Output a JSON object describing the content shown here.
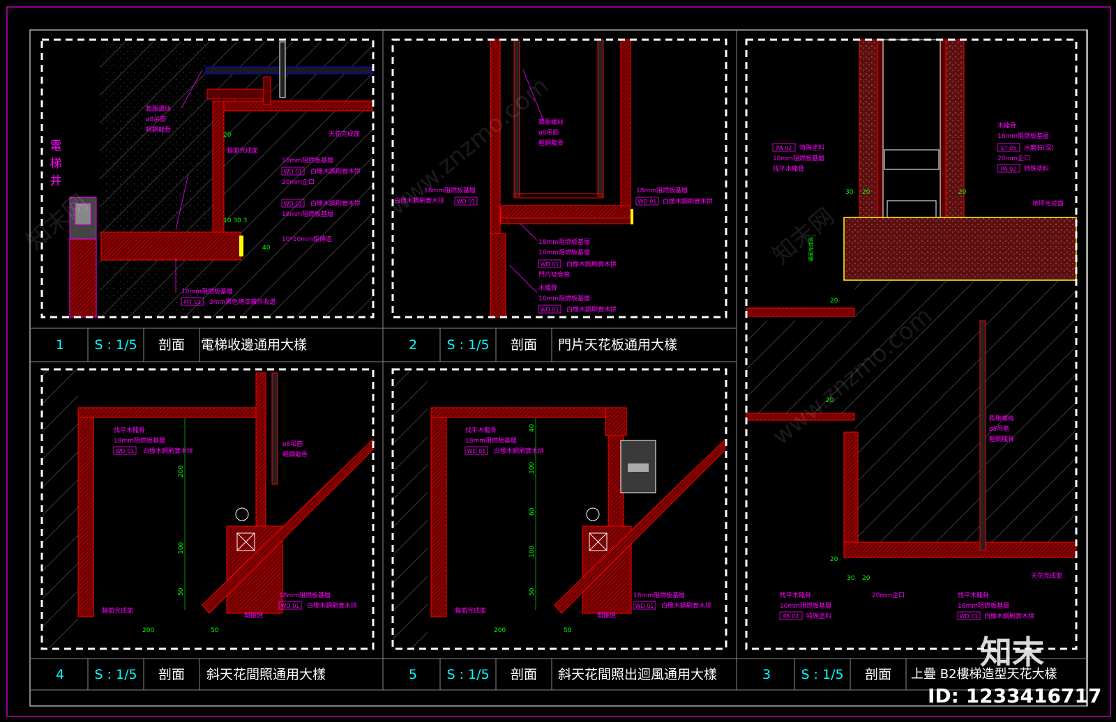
{
  "colors": {
    "frame": "#c000c0",
    "dash": "#ffffff",
    "leader": "#ff00ff",
    "wall": "#ff0000",
    "dim": "#00ff00",
    "accent": "#00ffff",
    "dark_red": "#5a0000"
  },
  "panels": [
    {
      "number": "1",
      "scale": "S : 1/5",
      "type": "剖面",
      "title": "電梯收邊通用大樣",
      "side_label": [
        "電",
        "梯",
        "井"
      ],
      "notes": [
        "膨脹螺絲",
        "ø8吊筋",
        "輕鋼龍骨",
        "天花完成面",
        "牆面完成面",
        "18mm阻燃板基層",
        "20mm企口",
        "18mm阻燃板基層",
        "10*10mm鋁條造",
        "10mm阻燃板基層",
        "3mm黑色烤漆鐵件收邊"
      ],
      "codes": [
        "WD 01",
        "WD 01",
        "MT 01"
      ],
      "code_texts": [
        "白橡木鋼刷實木拼",
        "白橡木鋼刷實木拼"
      ],
      "dims": [
        "20",
        "10 30 3",
        "40"
      ]
    },
    {
      "number": "2",
      "scale": "S : 1/5",
      "type": "剖面",
      "title": "門片天花板通用大樣",
      "notes": [
        "膨脹螺絲",
        "ø8吊筋",
        "輕鋼龍骨",
        "18mm阻燃板基層",
        "白橡木鋼刷實木拼",
        "18mm阻燃板基層",
        "18mm阻燃板基層",
        "10mm阻燃板基層",
        "白橡木鋼刷實木拼",
        "門片吸音棉",
        "木龍骨",
        "10mm阻燃板基層",
        "白橡木鋼刷實木拼"
      ],
      "codes": [
        "WD 01",
        "WD 01",
        "WD 01",
        "WD 01"
      ]
    },
    {
      "number": "3",
      "scale": "S : 1/5",
      "type": "剖面",
      "title": "上疊 B2樓梯造型天花大樣",
      "notes_top": [
        "木龍骨",
        "18mm阻燃板基層",
        "水磨石(深)",
        "20mm企口",
        "特殊塗料",
        "特殊塗料",
        "10mm阻燃板基層",
        "找平木龍骨",
        "地坪完成面"
      ],
      "codes_top": [
        "PA 02",
        "ST 05",
        "PA 02"
      ],
      "notes_bottom": [
        "膨脹螺絲",
        "ø8吊筋",
        "輕鋼龍骨",
        "天花完成面",
        "找平木龍骨",
        "10mm阻燃板基層",
        "特殊塗料",
        "20mm企口",
        "找平木龍骨",
        "18mm阻燃板基層",
        "白橡木鋼刷實木拼"
      ],
      "codes_bottom": [
        "PA 02",
        "WD 01"
      ],
      "dims": [
        "30",
        "20",
        "20",
        "20",
        "20",
        "20",
        "30",
        "20"
      ],
      "vertical_note": "牆面完成面"
    },
    {
      "number": "4",
      "scale": "S : 1/5",
      "type": "剖面",
      "title": "斜天花間照通用大樣",
      "notes": [
        "找平木龍骨",
        "18mm阻燃板基層",
        "白橡木鋼刷實木拼",
        "ø8吊筋",
        "輕鋼龍骨",
        "18mm阻燃板基層",
        "白橡木鋼刷實木拼",
        "牆面完成面",
        "間接燈"
      ],
      "codes": [
        "WD 01",
        "WD 01"
      ],
      "dims": [
        "200",
        "100",
        "50",
        "200",
        "50"
      ]
    },
    {
      "number": "5",
      "scale": "S : 1/5",
      "type": "剖面",
      "title": "斜天花間照出迴風通用大樣",
      "notes": [
        "找平木龍骨",
        "18mm阻燃板基層",
        "白橡木鋼刷實木拼",
        "18mm阻燃板基層",
        "白橡木鋼刷實木拼",
        "牆面完成面",
        "間接燈"
      ],
      "codes": [
        "WD 01",
        "WD 01"
      ],
      "dims": [
        "40",
        "100",
        "60",
        "100",
        "50",
        "200",
        "50"
      ]
    }
  ],
  "watermark": {
    "brand": "知末",
    "id": "ID: 1233416717",
    "site": "www.znzmo.com",
    "site_cn": "知末网"
  }
}
